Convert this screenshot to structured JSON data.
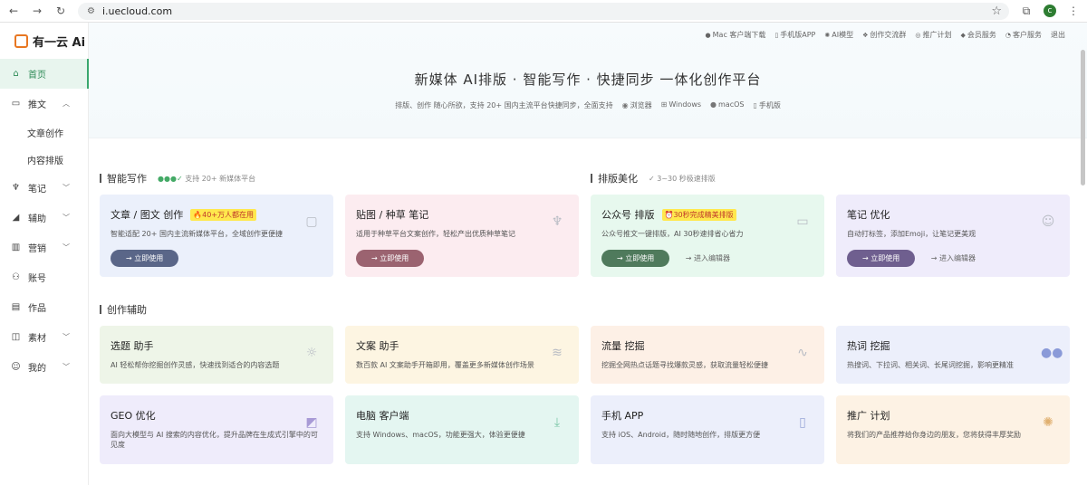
{
  "browser": {
    "url": "i.uecloud.com",
    "avatar_letter": "c"
  },
  "logo": {
    "text": "有一云 Ai"
  },
  "sidebar": {
    "items": [
      {
        "label": "首页",
        "icon": "home-icon",
        "active": true
      },
      {
        "label": "推文",
        "icon": "article-icon",
        "caret": "up"
      },
      {
        "label": "笔记",
        "icon": "sprout-icon",
        "caret": "down"
      },
      {
        "label": "辅助",
        "icon": "chart-icon",
        "caret": "down"
      },
      {
        "label": "营销",
        "icon": "bar-icon",
        "caret": "down"
      },
      {
        "label": "账号",
        "icon": "user-icon"
      },
      {
        "label": "作品",
        "icon": "works-icon"
      },
      {
        "label": "素材",
        "icon": "material-icon",
        "caret": "down"
      },
      {
        "label": "我的",
        "icon": "profile-icon",
        "caret": "down"
      }
    ],
    "subitems": [
      "文章创作",
      "内容排版"
    ]
  },
  "topbar": [
    "Mac 客户端下载",
    "手机版APP",
    "AI模型",
    "创作交流群",
    "推广计划",
    "会员服务",
    "客户服务",
    "退出"
  ],
  "hero": {
    "title": "新媒体 AI排版 · 智能写作 · 快捷同步 一体化创作平台",
    "subtitle": "排版、创作 随心所欲，支持 20+ 国内主流平台快捷同步，全面支持",
    "platforms": [
      "浏览器",
      "Windows",
      "macOS",
      "手机版"
    ]
  },
  "sections": {
    "writing": {
      "title": "智能写作",
      "note": "支持 20+ 新媒体平台"
    },
    "layout": {
      "title": "排版美化",
      "note": "3~30 秒极速排版"
    },
    "assist": {
      "title": "创作辅助"
    }
  },
  "cards_row1": [
    {
      "title": "文章 / 图文 创作",
      "badge": "🔥40+万人都在用",
      "desc": "智能适配 20+ 国内主流新媒体平台，全域创作更便捷",
      "btn": "→ 立即使用",
      "btn_color": "#5a6688"
    },
    {
      "title": "贴图 / 种草 笔记",
      "desc": "适用于种草平台文案创作，轻松产出优质种草笔记",
      "btn": "→ 立即使用",
      "btn_color": "#9b6370"
    },
    {
      "title": "公众号 排版",
      "badge": "⏰30秒完成精美排版",
      "desc": "公众号推文一键排版，AI 30秒速排省心省力",
      "btn": "→ 立即使用",
      "btn_color": "#4f7a5c",
      "link": "→ 进入编辑器"
    },
    {
      "title": "笔记 优化",
      "desc": "自动打标签，添加Emoji，让笔记更美观",
      "btn": "→ 立即使用",
      "btn_color": "#6f5f8f",
      "link": "→ 进入编辑器"
    }
  ],
  "cards_row2": [
    {
      "title": "选题 助手",
      "desc": "AI 轻松帮你挖掘创作灵感，快速找到适合的内容选题"
    },
    {
      "title": "文案 助手",
      "desc": "数百款 AI 文案助手开箱即用，覆盖更多新媒体创作场景"
    },
    {
      "title": "流量 挖掘",
      "desc": "挖掘全网热点话题寻找爆款灵感，获取流量轻松便捷"
    },
    {
      "title": "热词 挖掘",
      "desc": "热搜词、下拉词、相关词、长尾词挖掘，影响更精准"
    }
  ],
  "cards_row3": [
    {
      "title": "GEO 优化",
      "desc": "面向大模型与 AI 搜索的内容优化，提升品牌在生成式引擎中的可见度"
    },
    {
      "title": "电脑 客户端",
      "desc": "支持 Windows、macOS，功能更强大，体验更便捷"
    },
    {
      "title": "手机 APP",
      "desc": "支持 iOS、Android，随时随地创作，排版更方便"
    },
    {
      "title": "推广 计划",
      "desc": "将我们的产品推荐给你身边的朋友，您将获得丰厚奖励"
    }
  ]
}
